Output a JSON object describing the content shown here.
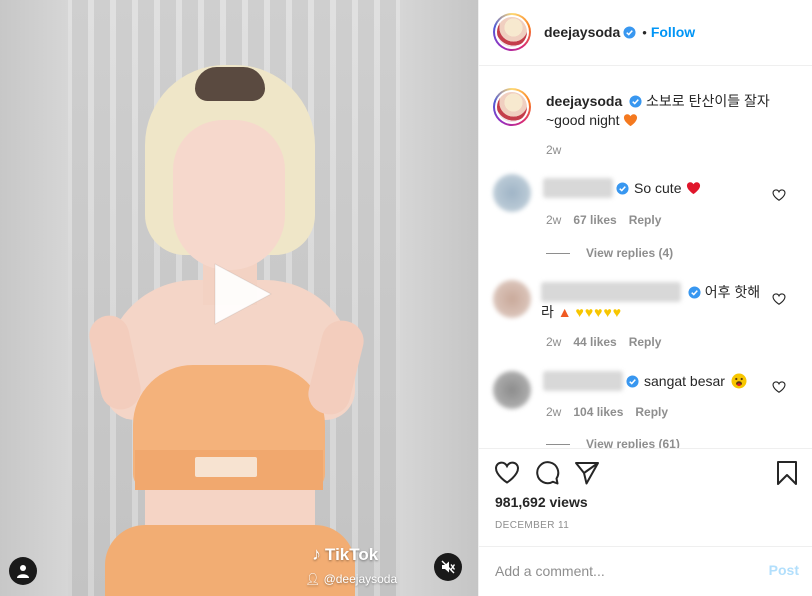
{
  "post": {
    "author": "deejaysoda",
    "follow_label": "Follow",
    "separator": "•",
    "caption_line1": "소보로 탄산이들 잘자",
    "caption_line2": "~good night",
    "caption_age": "2w"
  },
  "media": {
    "watermark_brand": "TikTok",
    "watermark_handle": "@deejaysoda"
  },
  "comments": [
    {
      "text": "So cute",
      "age": "2w",
      "likes": "67 likes",
      "reply_label": "Reply",
      "view_replies": "View replies (4)"
    },
    {
      "text_line1": "어후 핫해",
      "text_line2": "라",
      "age": "2w",
      "likes": "44 likes",
      "reply_label": "Reply"
    },
    {
      "text": "sangat besar",
      "age": "2w",
      "likes": "104 likes",
      "reply_label": "Reply",
      "view_replies": "View replies (61)"
    }
  ],
  "stats": {
    "views": "981,692 views",
    "date": "DECEMBER 11"
  },
  "add_comment": {
    "placeholder": "Add a comment...",
    "post_label": "Post"
  },
  "colors": {
    "accent": "#0095f6",
    "post_disabled": "#b2dffc",
    "muted_text": "#8e8e8e",
    "heart_red": "#ed4956"
  },
  "icons": {
    "play": "play-icon",
    "user_tag": "user-tag-icon",
    "mute": "mute-icon",
    "verified": "verified-badge-icon",
    "like": "heart-icon",
    "comment": "comment-icon",
    "share": "share-icon",
    "save": "bookmark-icon"
  }
}
